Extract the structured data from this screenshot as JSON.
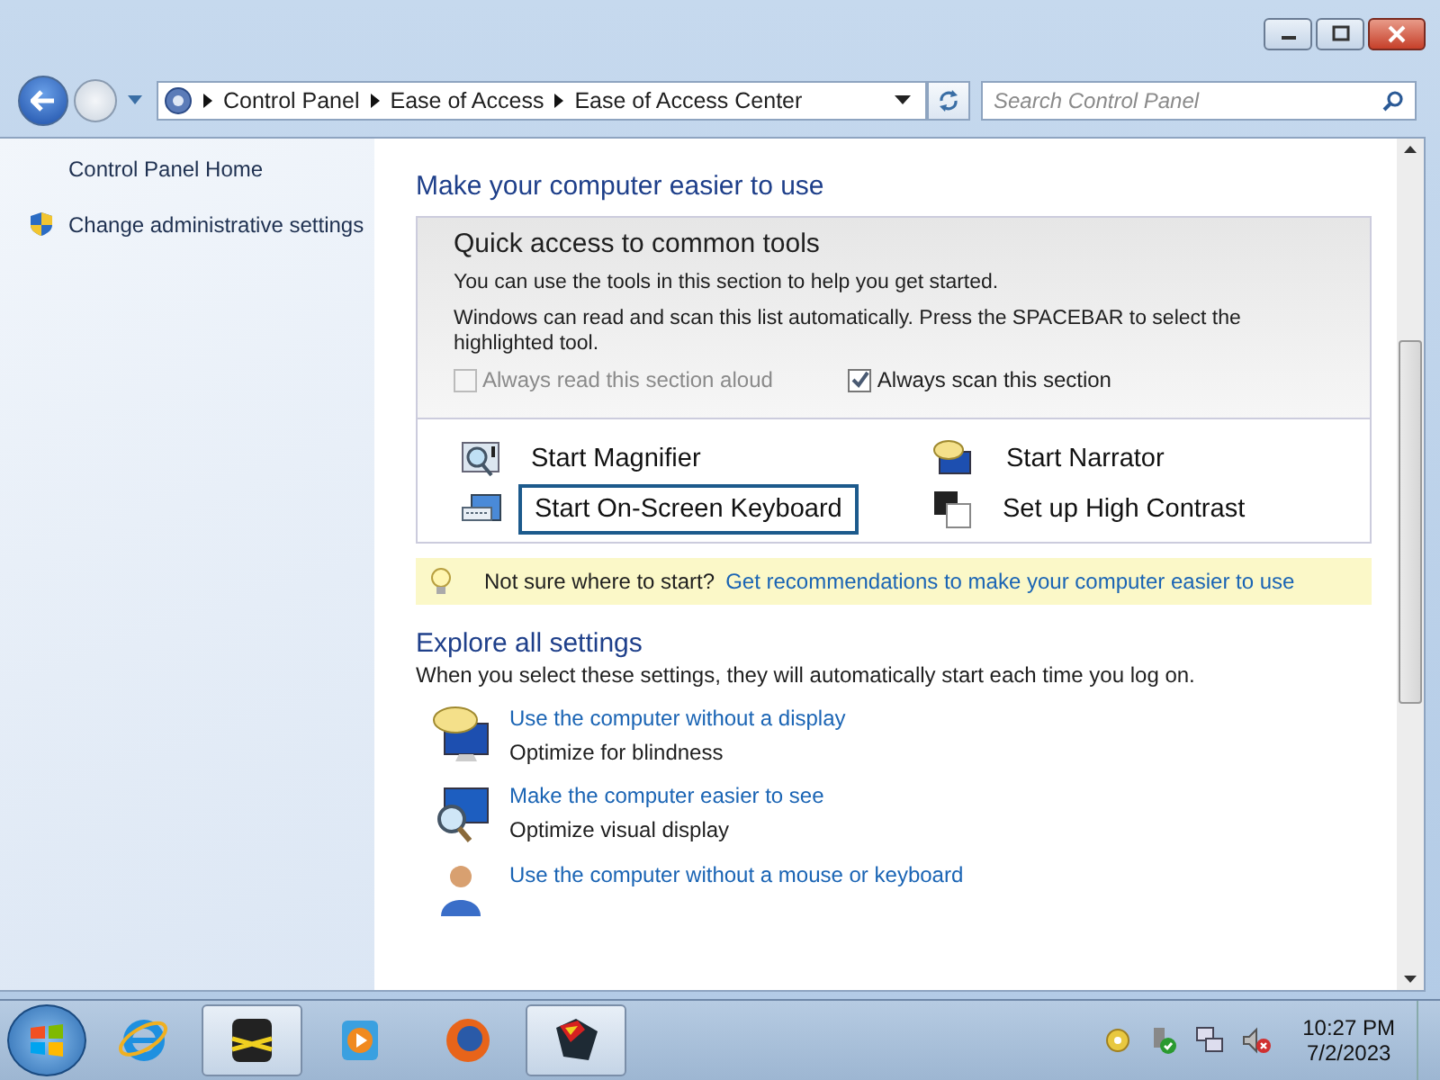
{
  "address": {
    "breadcrumbs": [
      "Control Panel",
      "Ease of Access",
      "Ease of Access Center"
    ],
    "search_placeholder": "Search Control Panel"
  },
  "sidebar": {
    "items": [
      {
        "label": "Control Panel Home",
        "kind": "plain"
      },
      {
        "label": "Change administrative settings",
        "kind": "shield"
      }
    ]
  },
  "heading": "Make your computer easier to use",
  "quick_access": {
    "title": "Quick access to common tools",
    "lines": [
      "You can use the tools in this section to help you get started.",
      "Windows can read and scan this list automatically.  Press the SPACEBAR to select the highlighted tool."
    ],
    "checkboxes": [
      {
        "label": "Always read this section aloud",
        "checked": false,
        "disabled": true
      },
      {
        "label": "Always scan this section",
        "checked": true,
        "disabled": false
      }
    ],
    "tools": [
      {
        "label": "Start Magnifier",
        "kind": "magnifier",
        "selected": false
      },
      {
        "label": "Start Narrator",
        "kind": "narrator",
        "selected": false
      },
      {
        "label": "Start On-Screen Keyboard",
        "kind": "keyboard",
        "selected": true
      },
      {
        "label": "Set up High Contrast",
        "kind": "contrast",
        "selected": false
      }
    ]
  },
  "tip": {
    "prefix": "Not sure where to start?",
    "link": "Get recommendations to make your computer easier to use"
  },
  "explore": {
    "title": "Explore all settings",
    "subtitle": "When you select these settings, they will automatically start each time you log on.",
    "items": [
      {
        "link": "Use the computer without a display",
        "description": "Optimize for blindness",
        "kind": "speech"
      },
      {
        "link": "Make the computer easier to see",
        "description": "Optimize visual display",
        "kind": "magnify"
      },
      {
        "link": "Use the computer without a mouse or keyboard",
        "kind": "person"
      }
    ]
  },
  "taskbar": {
    "apps": [
      {
        "kind": "ie",
        "active": false
      },
      {
        "kind": "cm",
        "active": true
      },
      {
        "kind": "media",
        "active": false
      },
      {
        "kind": "firefox",
        "active": false
      },
      {
        "kind": "hero",
        "active": true
      }
    ],
    "time": "10:27 PM",
    "date": "7/2/2023"
  }
}
